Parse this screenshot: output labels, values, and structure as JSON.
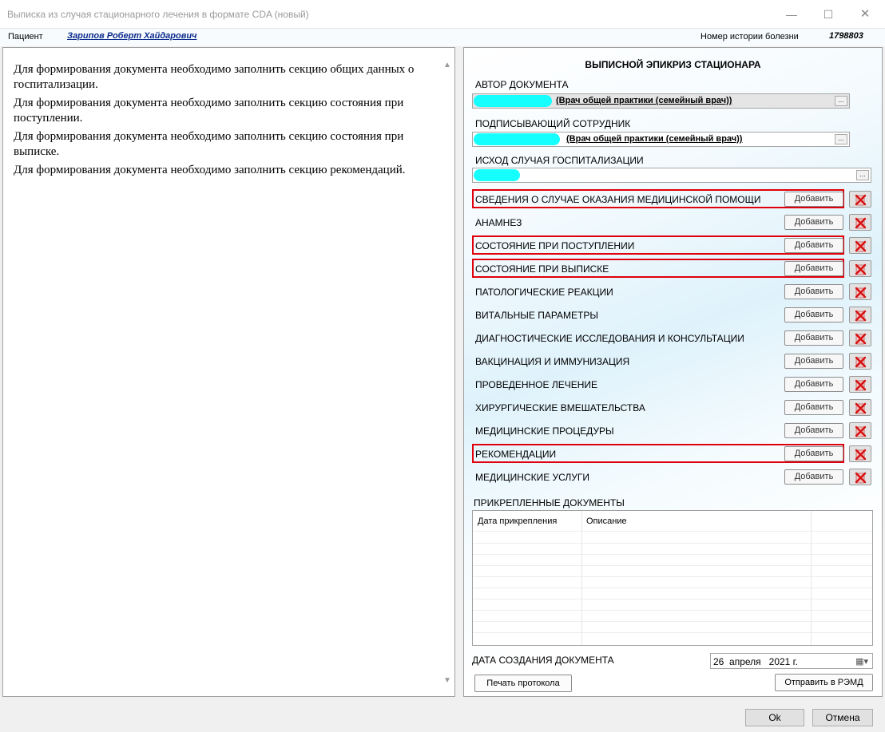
{
  "window": {
    "title": "Выписка из случая стационарного лечения в формате CDA (новый)",
    "minimize": "—",
    "maximize": "☐",
    "close": "✕"
  },
  "header": {
    "patient_label": "Пациент",
    "patient_name": "Зарипов Роберт Хайдарович",
    "history_label": "Номер истории болезни",
    "history_number": "1798803"
  },
  "messages": [
    "Для формирования документа необходимо заполнить секцию общих данных о госпитализации.",
    "Для формирования документа необходимо заполнить секцию состояния при поступлении.",
    "Для формирования документа необходимо заполнить секцию состояния при выписке.",
    "Для формирования документа необходимо заполнить секцию рекомендаций."
  ],
  "document": {
    "title": "ВЫПИСНОЙ ЭПИКРИЗ СТАЦИОНАРА",
    "author_label": "АВТОР ДОКУМЕНТА",
    "author_value": "(Врач общей практики (семейный врач))",
    "signer_label": "ПОДПИСЫВАЮЩИЙ СОТРУДНИК",
    "signer_value": "(Врач общей практики (семейный врач))",
    "outcome_label": "ИСХОД СЛУЧАЯ ГОСПИТАЛИЗАЦИИ",
    "ellipsis": "..."
  },
  "sections": [
    {
      "label": "СВЕДЕНИЯ О СЛУЧАЕ ОКАЗАНИЯ МЕДИЦИНСКОЙ ПОМОЩИ",
      "highlighted": true
    },
    {
      "label": "АНАМНЕЗ",
      "highlighted": false
    },
    {
      "label": "СОСТОЯНИЕ ПРИ ПОСТУПЛЕНИИ",
      "highlighted": true
    },
    {
      "label": "СОСТОЯНИЕ ПРИ ВЫПИСКЕ",
      "highlighted": true
    },
    {
      "label": "ПАТОЛОГИЧЕСКИЕ РЕАКЦИИ",
      "highlighted": false
    },
    {
      "label": "ВИТАЛЬНЫЕ ПАРАМЕТРЫ",
      "highlighted": false
    },
    {
      "label": "ДИАГНОСТИЧЕСКИЕ ИССЛЕДОВАНИЯ И КОНСУЛЬТАЦИИ",
      "highlighted": false
    },
    {
      "label": "ВАКЦИНАЦИЯ И ИММУНИЗАЦИЯ",
      "highlighted": false
    },
    {
      "label": "ПРОВЕДЕННОЕ ЛЕЧЕНИЕ",
      "highlighted": false
    },
    {
      "label": "ХИРУРГИЧЕСКИЕ ВМЕШАТЕЛЬСТВА",
      "highlighted": false
    },
    {
      "label": "МЕДИЦИНСКИЕ ПРОЦЕДУРЫ",
      "highlighted": false
    },
    {
      "label": "РЕКОМЕНДАЦИИ",
      "highlighted": true
    },
    {
      "label": "МЕДИЦИНСКИЕ УСЛУГИ",
      "highlighted": false
    }
  ],
  "add_label": "Добавить",
  "attachments": {
    "title": "ПРИКРЕПЛЕННЫЕ ДОКУМЕНТЫ",
    "columns": [
      "Дата прикрепления",
      "Описание"
    ]
  },
  "creation": {
    "label": "ДАТА СОЗДАНИЯ ДОКУМЕНТА",
    "value": "26  апреля   2021 г."
  },
  "buttons": {
    "print": "Печать протокола",
    "send": "Отправить в РЭМД",
    "ok": "Ok",
    "cancel": "Отмена"
  },
  "colors": {
    "highlight_border": "#e0000b",
    "redaction": "#16ffff",
    "patient_link": "#0a2a8c"
  }
}
